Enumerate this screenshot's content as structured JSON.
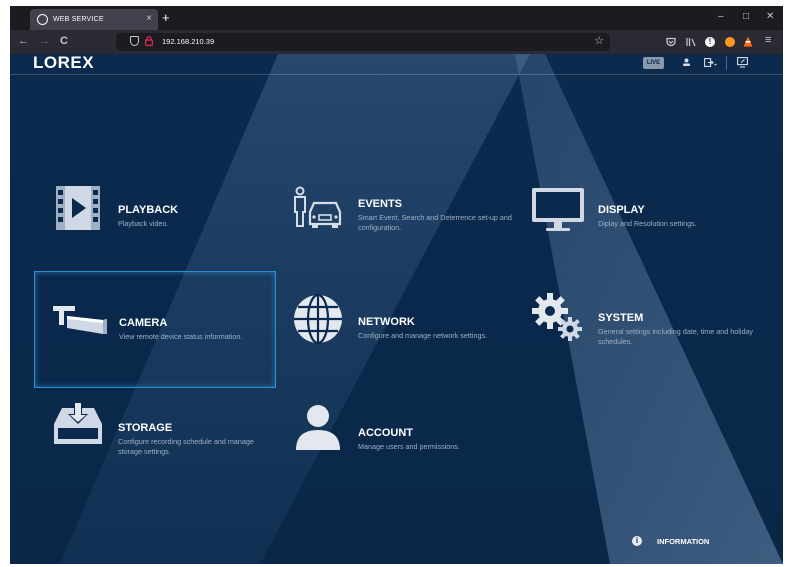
{
  "browser": {
    "tab_title": "WEB SERVICE",
    "tab_close": "×",
    "new_tab": "+",
    "minimize": "–",
    "maximize": "□",
    "close": "✕",
    "back": "←",
    "forward": "→",
    "reload": "C",
    "url": "192.168.210.39",
    "bookmark": "☆",
    "menu": "≡"
  },
  "app": {
    "logo": "LOREX",
    "live_label": "LIVE",
    "menu": [
      {
        "title": "PLAYBACK",
        "desc": "Playback video.",
        "icon": "playback-film-icon"
      },
      {
        "title": "EVENTS",
        "desc": "Smart Event, Search and Deterrence set-up and configuration.",
        "icon": "events-person-car-icon"
      },
      {
        "title": "DISPLAY",
        "desc": "Diplay and Resolution settings.",
        "icon": "display-monitor-icon"
      },
      {
        "title": "CAMERA",
        "desc": "View remote device status information.",
        "icon": "camera-icon"
      },
      {
        "title": "NETWORK",
        "desc": "Configure and manage network settings.",
        "icon": "network-globe-icon"
      },
      {
        "title": "SYSTEM",
        "desc": "General settings including date, time and holiday schedules.",
        "icon": "system-gears-icon"
      },
      {
        "title": "STORAGE",
        "desc": "Configure recording schedule and manage storage settings.",
        "icon": "storage-drive-icon"
      },
      {
        "title": "ACCOUNT",
        "desc": "Manage users and permissions.",
        "icon": "account-user-icon"
      }
    ],
    "selected_item": "CAMERA",
    "info_label": "INFORMATION",
    "info_icon": "i"
  },
  "colors": {
    "background": "#0b2a4e",
    "accent": "#2c8fd6",
    "description": "#9eb0c8"
  }
}
